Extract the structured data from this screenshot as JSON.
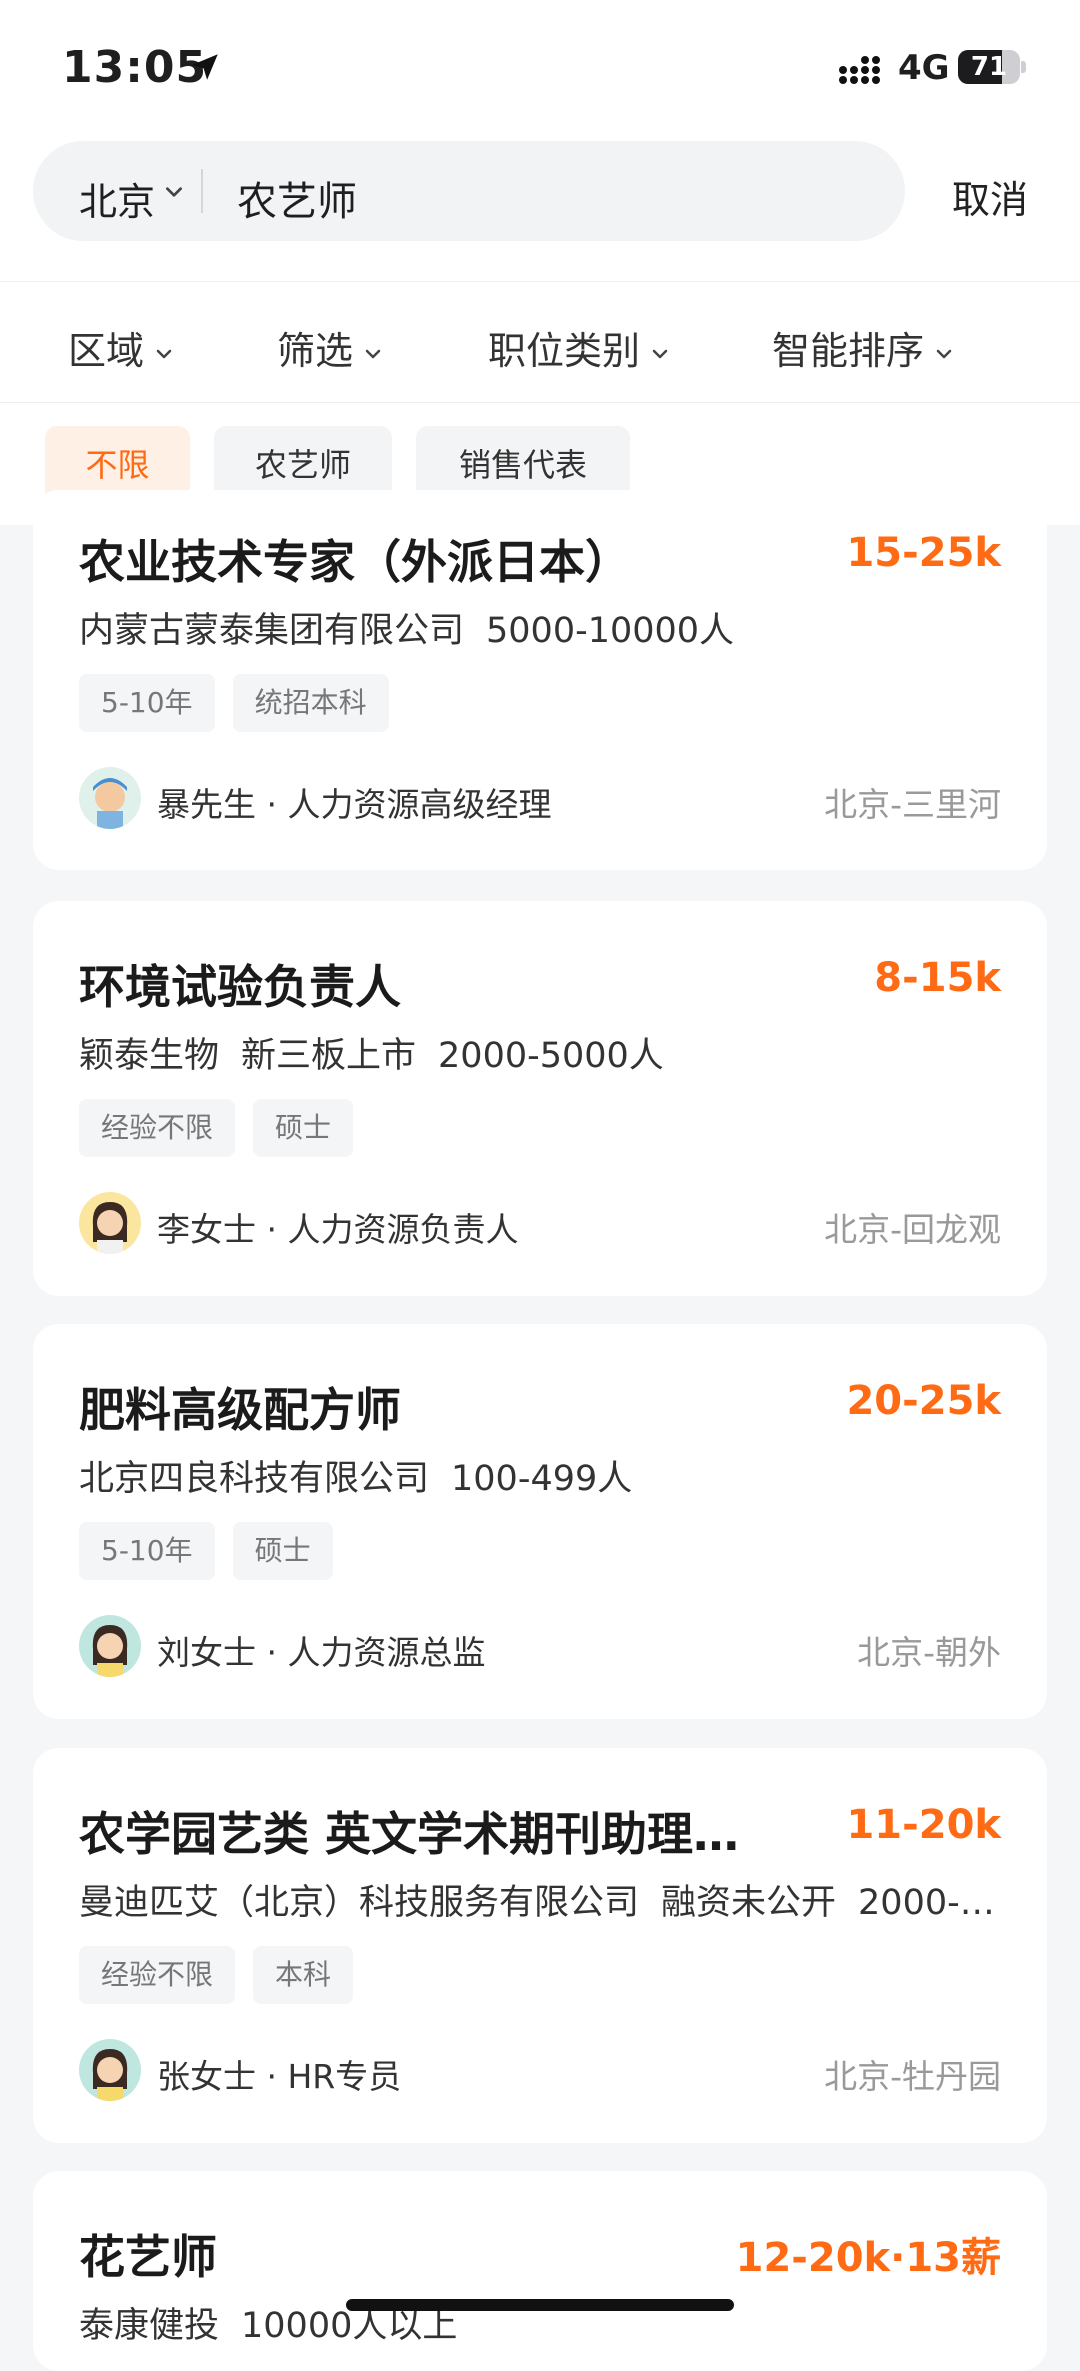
{
  "status_bar": {
    "time": "13:05",
    "network": "4G",
    "battery": "71",
    "battery_level": 0.71
  },
  "search": {
    "city": "北京",
    "query": "农艺师",
    "cancel_label": "取消"
  },
  "filters": [
    "区域",
    "筛选",
    "职位类别",
    "智能排序"
  ],
  "quick_tags": [
    {
      "label": "不限",
      "active": true
    },
    {
      "label": "农艺师",
      "active": false
    },
    {
      "label": "销售代表",
      "active": false
    }
  ],
  "jobs": [
    {
      "title": "农业技术专家（外派日本）",
      "salary": "15-25k",
      "company": [
        "内蒙古蒙泰集团有限公司",
        "5000-10000人"
      ],
      "tags": [
        "5-10年",
        "统招本科"
      ],
      "recruiter": "暴先生 · 人力资源高级经理",
      "location": "北京-三里河",
      "avatar": "male-recruiter-avatar"
    },
    {
      "title": "环境试验负责人",
      "salary": "8-15k",
      "company": [
        "颖泰生物",
        "新三板上市",
        "2000-5000人"
      ],
      "tags": [
        "经验不限",
        "硕士"
      ],
      "recruiter": "李女士 · 人力资源负责人",
      "location": "北京-回龙观",
      "avatar": "female-recruiter-avatar"
    },
    {
      "title": "肥料高级配方师",
      "salary": "20-25k",
      "company": [
        "北京四良科技有限公司",
        "100-499人"
      ],
      "tags": [
        "5-10年",
        "硕士"
      ],
      "recruiter": "刘女士 · 人力资源总监",
      "location": "北京-朝外",
      "avatar": "female-recruiter-avatar"
    },
    {
      "title": "农学园艺类 英文学术期刊助理…",
      "salary": "11-20k",
      "company": [
        "曼迪匹艾（北京）科技服务有限公司",
        "融资未公开",
        "2000-…"
      ],
      "tags": [
        "经验不限",
        "本科"
      ],
      "recruiter": "张女士 · HR专员",
      "location": "北京-牡丹园",
      "avatar": "female-recruiter-avatar"
    },
    {
      "title": "花艺师",
      "salary": "12-20k·13薪",
      "company": [
        "泰康健投",
        "10000人以上"
      ]
    }
  ],
  "colors": {
    "accent": "#ff6a14",
    "background": "#f5f6f8",
    "card": "#ffffff"
  }
}
